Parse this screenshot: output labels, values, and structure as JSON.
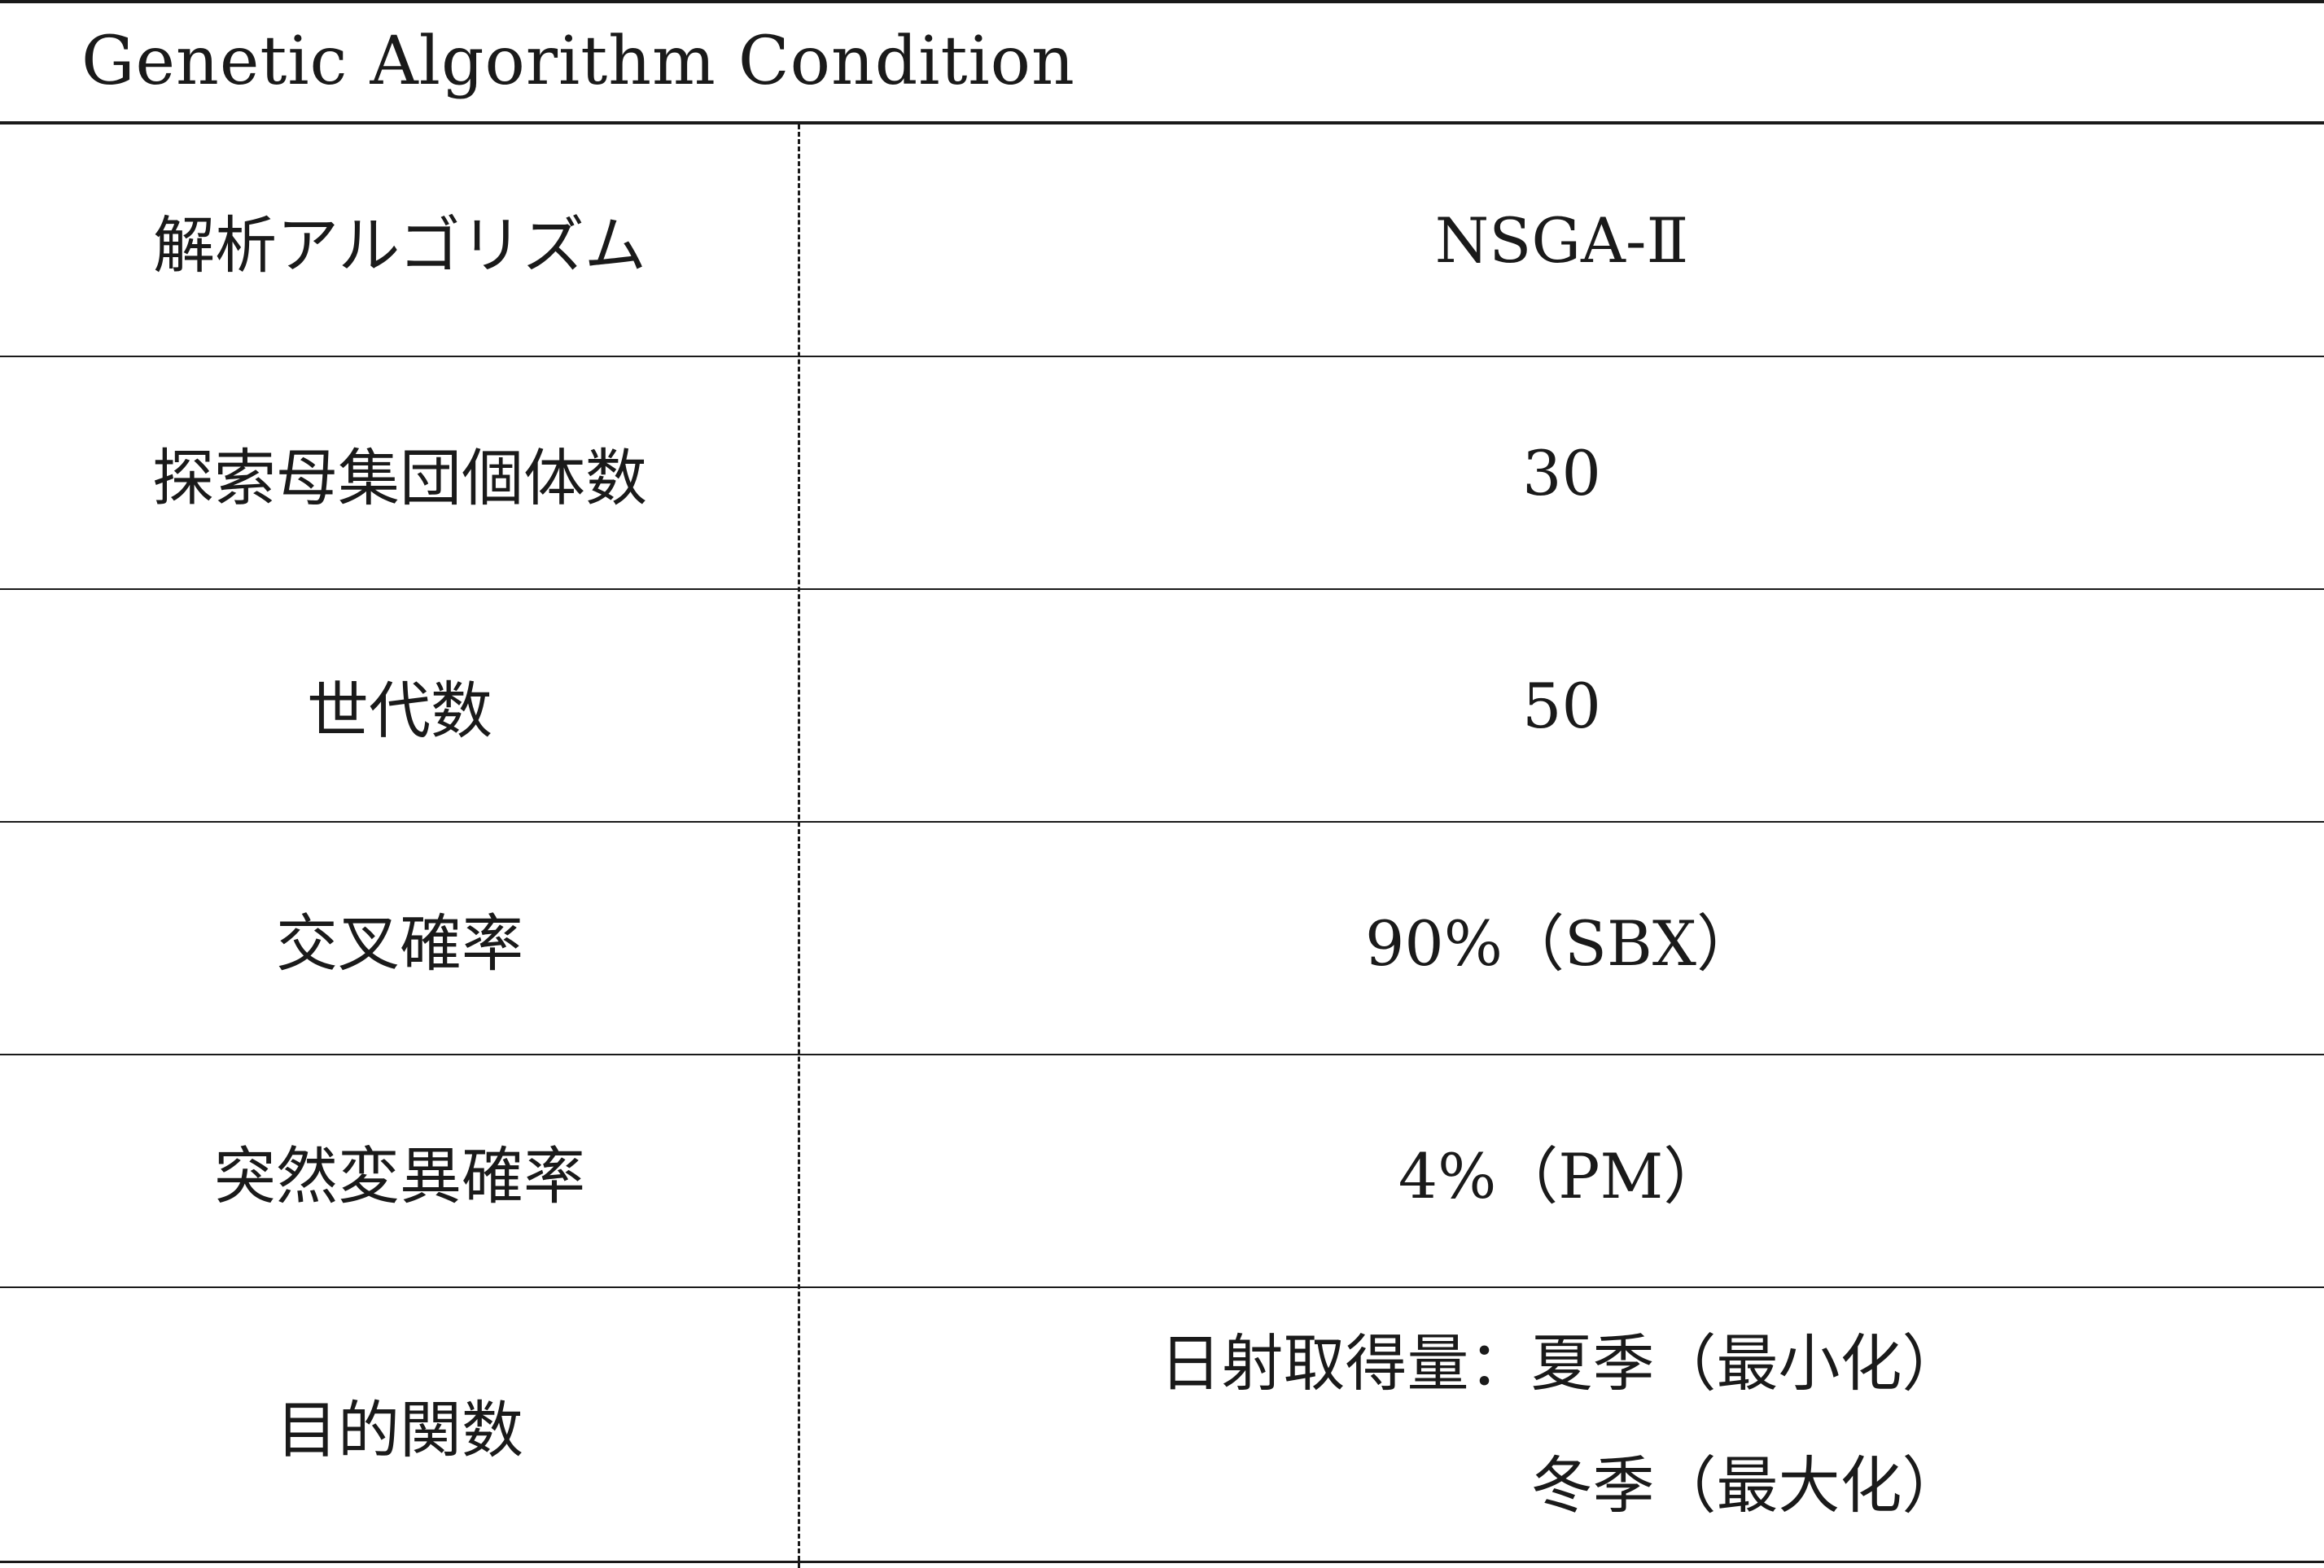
{
  "table": {
    "title": "Genetic Algorithm Condition",
    "rows": [
      {
        "label": "解析アルゴリズム",
        "value": "NSGA-Ⅱ"
      },
      {
        "label": "探索母集団個体数",
        "value": "30"
      },
      {
        "label": "世代数",
        "value": "50"
      },
      {
        "label": "交叉確率",
        "value": "90%（SBX）"
      },
      {
        "label": "突然変異確率",
        "value": "4%（PM）"
      },
      {
        "label": "目的関数",
        "value_lines": [
          "日射取得量：夏季（最小化）",
          "冬季（最大化）"
        ]
      }
    ]
  }
}
